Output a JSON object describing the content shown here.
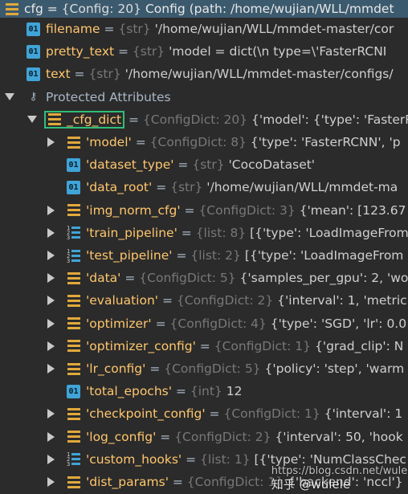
{
  "root": {
    "name": "cfg",
    "eq": " = ",
    "type": "{Config: 20}",
    "value": "Config (path: /home/wujian/WLL/mmdet"
  },
  "attributes": [
    {
      "name": "filename",
      "type": "{str}",
      "value": "'/home/wujian/WLL/mmdet-master/cor"
    },
    {
      "name": "pretty_text",
      "type": "{str}",
      "value": "'model = dict(\\n    type=\\'FasterRCNI"
    },
    {
      "name": "text",
      "type": "{str}",
      "value": "'/home/wujian/WLL/mmdet-master/configs/"
    }
  ],
  "protected": {
    "label": "Protected Attributes",
    "cfg_dict": {
      "name": "_cfg_dict",
      "type": "{ConfigDict: 20}",
      "value": "{'model': {'type': 'FasterR"
    }
  },
  "children": [
    {
      "name": "'model'",
      "type": "{ConfigDict: 8}",
      "value": "{'type': 'FasterRCNN', 'p",
      "icon": "dict",
      "expandable": true
    },
    {
      "name": "'dataset_type'",
      "type": "{str}",
      "value": "'CocoDataset'",
      "icon": "01",
      "expandable": false
    },
    {
      "name": "'data_root'",
      "type": "{str}",
      "value": "'/home/wujian/WLL/mmdet-ma",
      "icon": "01",
      "expandable": false
    },
    {
      "name": "'img_norm_cfg'",
      "type": "{ConfigDict: 3}",
      "value": "{'mean': [123.67",
      "icon": "dict",
      "expandable": true
    },
    {
      "name": "'train_pipeline'",
      "type": "{list: 8}",
      "value": "[{'type': 'LoadImageFrom",
      "icon": "list",
      "expandable": true
    },
    {
      "name": "'test_pipeline'",
      "type": "{list: 2}",
      "value": "[{'type': 'LoadImageFrom",
      "icon": "list",
      "expandable": true
    },
    {
      "name": "'data'",
      "type": "{ConfigDict: 5}",
      "value": "{'samples_per_gpu': 2, 'wo",
      "icon": "dict",
      "expandable": true
    },
    {
      "name": "'evaluation'",
      "type": "{ConfigDict: 2}",
      "value": "{'interval': 1, 'metric",
      "icon": "dict",
      "expandable": true
    },
    {
      "name": "'optimizer'",
      "type": "{ConfigDict: 4}",
      "value": "{'type': 'SGD', 'lr': 0.0",
      "icon": "dict",
      "expandable": true
    },
    {
      "name": "'optimizer_config'",
      "type": "{ConfigDict: 1}",
      "value": "{'grad_clip': N",
      "icon": "dict",
      "expandable": true
    },
    {
      "name": "'lr_config'",
      "type": "{ConfigDict: 5}",
      "value": "{'policy': 'step', 'warm",
      "icon": "dict",
      "expandable": true
    },
    {
      "name": "'total_epochs'",
      "type": "{int}",
      "value": "12",
      "icon": "01",
      "expandable": false
    },
    {
      "name": "'checkpoint_config'",
      "type": "{ConfigDict: 1}",
      "value": "{'interval': 1",
      "icon": "dict",
      "expandable": true
    },
    {
      "name": "'log_config'",
      "type": "{ConfigDict: 2}",
      "value": "{'interval': 50, 'hook",
      "icon": "dict",
      "expandable": true
    },
    {
      "name": "'custom_hooks'",
      "type": "{list: 1}",
      "value": "[{'type': 'NumClassChec",
      "icon": "list",
      "expandable": true
    },
    {
      "name": "'dist_params'",
      "type": "{ConfigDict: 1}",
      "value": "{'backend': 'nccl'}",
      "icon": "dict",
      "expandable": true
    }
  ],
  "watermark": "知乎 @wulele",
  "url_watermark": "https://blog.csdn.net/wulele"
}
